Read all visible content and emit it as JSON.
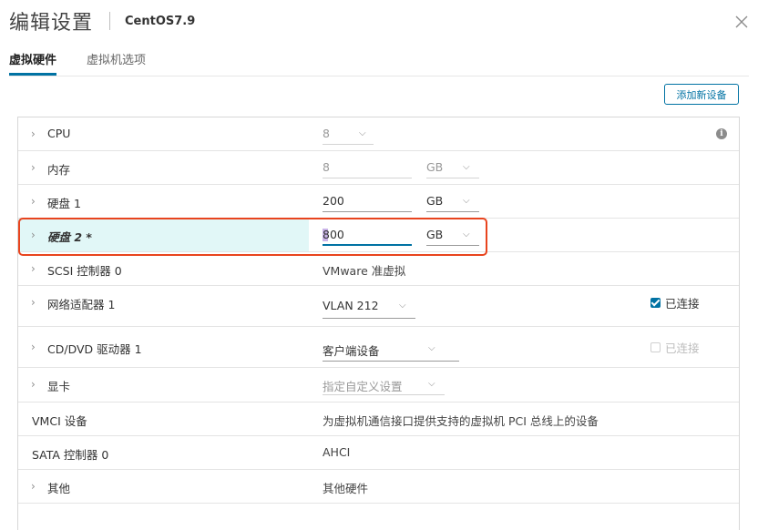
{
  "dialog": {
    "title": "编辑设置",
    "vm_name": "CentOS7.9"
  },
  "tabs": [
    {
      "label": "虚拟硬件",
      "active": true
    },
    {
      "label": "虚拟机选项",
      "active": false
    }
  ],
  "add_device_label": "添加新设备",
  "hardware": {
    "cpu": {
      "label": "CPU",
      "value": "8",
      "info_icon": "i"
    },
    "memory": {
      "label": "内存",
      "value": "8",
      "unit": "GB"
    },
    "disk1": {
      "label": "硬盘 1",
      "value": "200",
      "unit": "GB"
    },
    "disk2": {
      "label": "硬盘 2 *",
      "value": "800",
      "unit": "GB"
    },
    "scsi": {
      "label": "SCSI 控制器 0",
      "value": "VMware 准虚拟"
    },
    "network": {
      "label": "网络适配器 1",
      "value": "VLAN 212",
      "connect_label": "已连接",
      "connected": true
    },
    "cdrom": {
      "label": "CD/DVD 驱动器 1",
      "value": "客户端设备",
      "connect_label": "已连接",
      "connected": false
    },
    "video": {
      "label": "显卡",
      "value": "指定自定义设置"
    },
    "vmci": {
      "label": "VMCI 设备",
      "value": "为虚拟机通信接口提供支持的虚拟机 PCI 总线上的设备"
    },
    "sata": {
      "label": "SATA 控制器 0",
      "value": "AHCI"
    },
    "other": {
      "label": "其他",
      "value": "其他硬件"
    }
  },
  "colors": {
    "accent": "#0072a3",
    "selected_row": "#e1f7f7",
    "highlight": "#e8441e"
  }
}
